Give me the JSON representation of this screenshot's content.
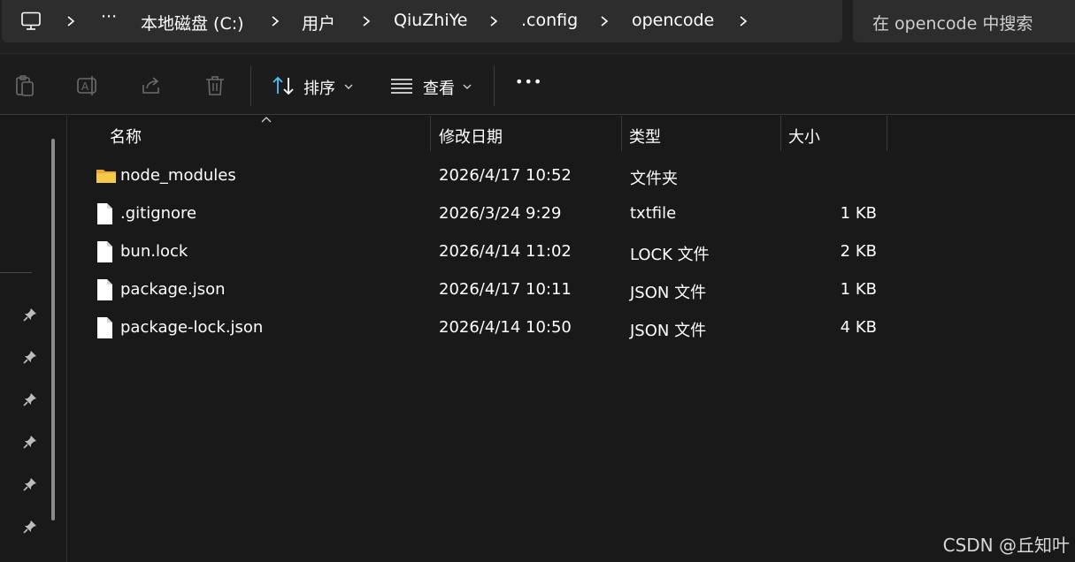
{
  "breadcrumb": {
    "items": [
      "本地磁盘 (C:)",
      "用户",
      "QiuZhiYe",
      ".config",
      "opencode"
    ],
    "more": "···"
  },
  "search": {
    "placeholder": "在 opencode 中搜索"
  },
  "toolbar": {
    "sort_label": "排序",
    "view_label": "查看",
    "more_label": "•••"
  },
  "columns": {
    "name": "名称",
    "modified": "修改日期",
    "type": "类型",
    "size": "大小"
  },
  "files": [
    {
      "name": "node_modules",
      "modified": "2026/4/17 10:52",
      "type": "文件夹",
      "size": "",
      "icon": "folder-icon"
    },
    {
      "name": ".gitignore",
      "modified": "2026/3/24 9:29",
      "type": "txtfile",
      "size": "1 KB",
      "icon": "file-icon"
    },
    {
      "name": "bun.lock",
      "modified": "2026/4/14 11:02",
      "type": "LOCK 文件",
      "size": "2 KB",
      "icon": "file-icon"
    },
    {
      "name": "package.json",
      "modified": "2026/4/17 10:11",
      "type": "JSON 文件",
      "size": "1 KB",
      "icon": "file-icon"
    },
    {
      "name": "package-lock.json",
      "modified": "2026/4/14 10:50",
      "type": "JSON 文件",
      "size": "4 KB",
      "icon": "file-icon"
    }
  ],
  "watermark": "CSDN @丘知叶",
  "colors": {
    "accent": "#4cc2ff",
    "folder": "#f7c948",
    "background": "#191919"
  }
}
